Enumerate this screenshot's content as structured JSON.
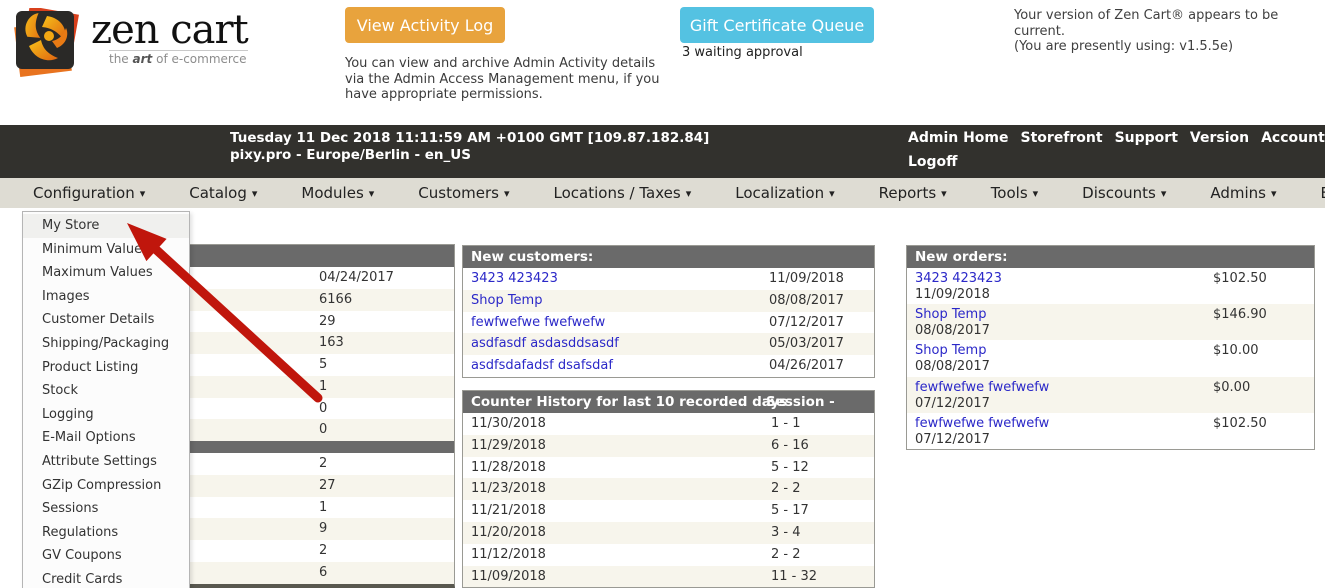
{
  "header": {
    "logo": {
      "title": "zen cart",
      "tagline_pre": "the ",
      "tagline_em": "art",
      "tagline_post": " of e-commerce"
    },
    "activity": {
      "button_label": "View Activity Log",
      "note": "You can view and archive Admin Activity details via the Admin Access Management menu, if you have appropriate permissions."
    },
    "gift": {
      "button_label": "Gift Certificate Queue",
      "status": "3 waiting approval"
    },
    "version": {
      "line1": "Your version of Zen Cart® appears to be current.",
      "line2": "(You are presently using: v1.5.5e)"
    }
  },
  "infobar": {
    "datetime": "Tuesday 11 Dec 2018 11:11:59 AM +0100 GMT [109.87.182.84]",
    "site": "pixy.pro - Europe/Berlin - en_US",
    "links_row1": [
      "Admin Home",
      "Storefront",
      "Support",
      "Version",
      "Account"
    ],
    "links_row2": [
      "Logoff"
    ]
  },
  "menu": {
    "items": [
      "Configuration",
      "Catalog",
      "Modules",
      "Customers",
      "Locations / Taxes",
      "Localization",
      "Reports",
      "Tools",
      "Discounts",
      "Admins",
      "Extras"
    ]
  },
  "dropdown": {
    "active": "My Store",
    "items": [
      "My Store",
      "Minimum Values",
      "Maximum Values",
      "Images",
      "Customer Details",
      "Shipping/Packaging",
      "Product Listing",
      "Stock",
      "Logging",
      "E-Mail Options",
      "Attribute Settings",
      "GZip Compression",
      "Sessions",
      "Regulations",
      "GV Coupons",
      "Credit Cards"
    ]
  },
  "stats": {
    "section1": [
      "04/24/2017",
      "6166",
      "29",
      "163",
      "5",
      "1",
      "0",
      "0"
    ],
    "section2": [
      "2",
      "27",
      "1",
      "9",
      "2",
      "6"
    ]
  },
  "new_customers": {
    "title": "New customers:",
    "rows": [
      {
        "name": "3423 423423",
        "date": "11/09/2018"
      },
      {
        "name": "Shop Temp",
        "date": "08/08/2017"
      },
      {
        "name": "fewfwefwe fwefwefw",
        "date": "07/12/2017"
      },
      {
        "name": "asdfasdf asdasddsasdf",
        "date": "05/03/2017"
      },
      {
        "name": "asdfsdafadsf dsafsdaf",
        "date": "04/26/2017"
      }
    ]
  },
  "counter_history": {
    "title": "Counter History for last 10 recorded days",
    "col2": "Session - Total",
    "rows": [
      {
        "date": "11/30/2018",
        "value": "1 - 1"
      },
      {
        "date": "11/29/2018",
        "value": "6 - 16"
      },
      {
        "date": "11/28/2018",
        "value": "5 - 12"
      },
      {
        "date": "11/23/2018",
        "value": "2 - 2"
      },
      {
        "date": "11/21/2018",
        "value": "5 - 17"
      },
      {
        "date": "11/20/2018",
        "value": "3 - 4"
      },
      {
        "date": "11/12/2018",
        "value": "2 - 2"
      },
      {
        "date": "11/09/2018",
        "value": "11 - 32"
      }
    ]
  },
  "new_orders": {
    "title": "New orders:",
    "rows": [
      {
        "name": "3423 423423",
        "date": "11/09/2018",
        "amount": "$102.50"
      },
      {
        "name": "Shop Temp",
        "date": "08/08/2017",
        "amount": "$146.90"
      },
      {
        "name": "Shop Temp",
        "date": "08/08/2017",
        "amount": "$10.00"
      },
      {
        "name": "fewfwefwe fwefwefw",
        "date": "07/12/2017",
        "amount": "$0.00"
      },
      {
        "name": "fewfwefwe fwefwefw",
        "date": "07/12/2017",
        "amount": "$102.50"
      }
    ]
  },
  "colors": {
    "accent-orange": "#e8a33d",
    "accent-blue": "#54c2e2",
    "bar-dark": "#32312d",
    "menubar-bg": "#dedcd3",
    "panel-header": "#6a6a6a",
    "row-alt": "#f7f5ec",
    "link-blue": "#2b28c8",
    "arrow-red": "#c0160c"
  }
}
